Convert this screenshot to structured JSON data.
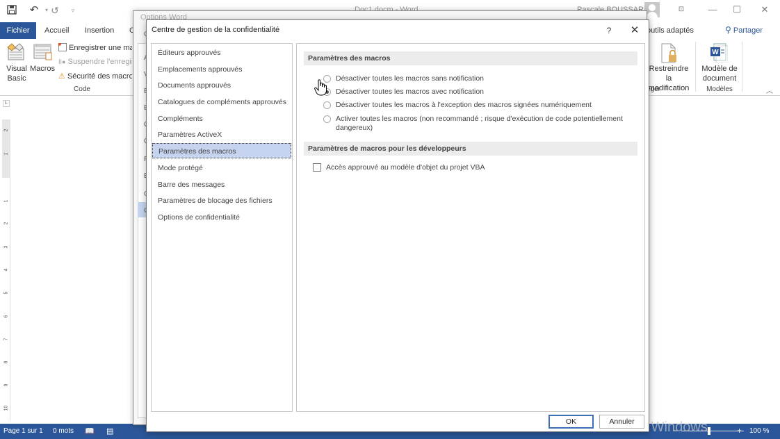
{
  "app": {
    "document_title": "Doc1.docm - Word",
    "user_name": "Pascale BOUSSARD"
  },
  "quick_access": {
    "icons": [
      "save-icon",
      "undo-icon",
      "redo-icon",
      "customize-icon"
    ]
  },
  "window_controls": {
    "icons": [
      "ribbon-display-icon",
      "minimize-icon",
      "maximize-icon",
      "close-icon"
    ]
  },
  "tabs": {
    "file": "Fichier",
    "items": [
      "Accueil",
      "Insertion",
      "C"
    ],
    "right_partial": "outils adaptés",
    "share": "Partager"
  },
  "ribbon": {
    "code_group": {
      "visual_basic": "Visual Basic",
      "visual_basic_line1": "Visual",
      "visual_basic_line2": "Basic",
      "macros": "Macros",
      "record_macro": "Enregistrer une mac",
      "pause_recording": "Suspendre l'enregis",
      "macro_security": "Sécurité des macros",
      "label": "Code"
    },
    "protect_group": {
      "restrict_line1": "Restreindre la",
      "restrict_line2": "modification",
      "label_partial": "éger"
    },
    "templates_group": {
      "doc_template_line1": "Modèle de",
      "doc_template_line2": "document",
      "label": "Modèles"
    }
  },
  "ruler": {
    "corner": "L",
    "numbers": [
      "2",
      "1",
      "1",
      "2",
      "3",
      "4",
      "5",
      "6",
      "7",
      "8",
      "9",
      "10"
    ]
  },
  "status_bar": {
    "page": "Page 1 sur 1",
    "words": "0 mots",
    "zoom_minus": "−",
    "zoom_plus": "+",
    "zoom_level": "100 %",
    "zoom_percent": 100
  },
  "watermark": "Activer Windows",
  "options_word": {
    "title": "Options Word",
    "nav_letters": [
      "G",
      "A",
      "V",
      "E",
      "E",
      "C",
      "C",
      "P",
      "E",
      "C",
      "C"
    ]
  },
  "trust_center": {
    "title": "Centre de gestion de la confidentialité",
    "help": "?",
    "close": "✕",
    "nav": [
      {
        "label": "Éditeurs approuvés",
        "selected": false
      },
      {
        "label": "Emplacements approuvés",
        "selected": false
      },
      {
        "label": "Documents approuvés",
        "selected": false
      },
      {
        "label": "Catalogues de compléments approuvés",
        "selected": false
      },
      {
        "label": "Compléments",
        "selected": false
      },
      {
        "label": "Paramètres ActiveX",
        "selected": false
      },
      {
        "label": "Paramètres des macros",
        "selected": true
      },
      {
        "label": "Mode protégé",
        "selected": false
      },
      {
        "label": "Barre des messages",
        "selected": false
      },
      {
        "label": "Paramètres de blocage des fichiers",
        "selected": false
      },
      {
        "label": "Options de confidentialité",
        "selected": false
      }
    ],
    "macro_section": {
      "heading": "Paramètres des macros",
      "options": [
        {
          "label": "Désactiver toutes les macros sans notification",
          "checked": false
        },
        {
          "label": "Désactiver toutes les macros avec notification",
          "checked": true
        },
        {
          "label": "Désactiver toutes les macros à l'exception des macros signées numériquement",
          "checked": false
        },
        {
          "label": "Activer toutes les macros (non recommandé ; risque d'exécution de code potentiellement dangereux)",
          "checked": false
        }
      ]
    },
    "developer_section": {
      "heading": "Paramètres de macros pour les développeurs",
      "checkbox_label": "Accès approuvé au modèle d'objet du projet VBA",
      "checked": false
    },
    "ok": "OK",
    "cancel": "Annuler"
  }
}
